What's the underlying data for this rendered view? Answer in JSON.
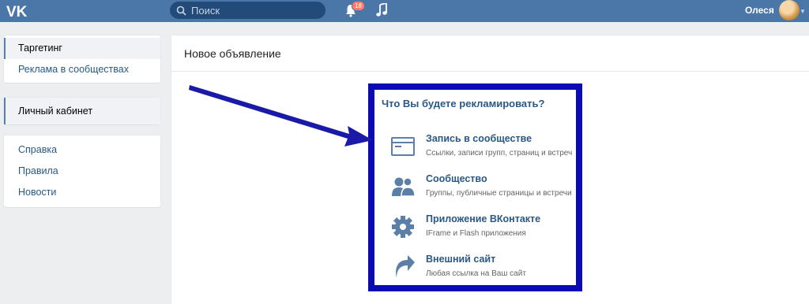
{
  "topbar": {
    "search_placeholder": "Поиск",
    "notifications_count": "18",
    "username": "Олеся"
  },
  "sidebar": {
    "group1": [
      {
        "label": "Таргетинг",
        "active": true
      },
      {
        "label": "Реклама в сообществах",
        "active": false
      }
    ],
    "group2": [
      {
        "label": "Личный кабинет",
        "active": true
      }
    ],
    "group3": [
      {
        "label": "Справка"
      },
      {
        "label": "Правила"
      },
      {
        "label": "Новости"
      }
    ]
  },
  "main": {
    "title": "Новое объявление",
    "picker": {
      "title": "Что Вы будете рекламировать?",
      "options": [
        {
          "title": "Запись в сообществе",
          "desc": "Ссылки, записи групп, страниц и встреч",
          "icon": "post-icon"
        },
        {
          "title": "Сообщество",
          "desc": "Группы, публичные страницы и встречи",
          "icon": "community-icon"
        },
        {
          "title": "Приложение ВКонтакте",
          "desc": "IFrame и Flash приложения",
          "icon": "gear-icon"
        },
        {
          "title": "Внешний сайт",
          "desc": "Любая ссылка на Ваш сайт",
          "icon": "external-arrow-icon"
        }
      ]
    }
  },
  "colors": {
    "header": "#4a76a8",
    "link": "#2a5885",
    "highlight_box": "#0a0ab6",
    "annotation_arrow": "#1a1aa8"
  }
}
